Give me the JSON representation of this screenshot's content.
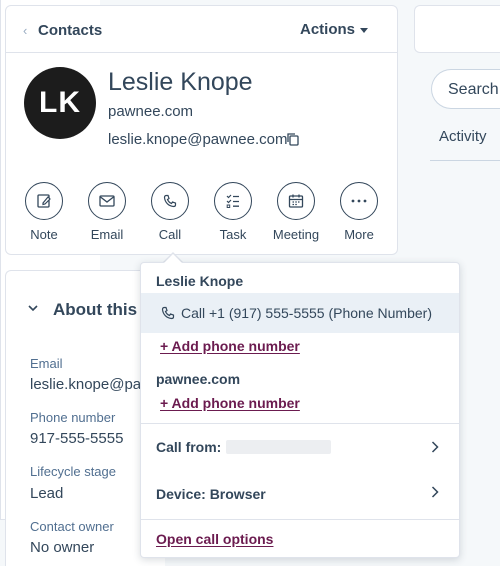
{
  "header": {
    "back_chevron": "‹",
    "title": "Contacts",
    "actions_label": "Actions"
  },
  "contact": {
    "initials": "LK",
    "name": "Leslie Knope",
    "domain": "pawnee.com",
    "email": "leslie.knope@pawnee.com"
  },
  "quick_actions": [
    {
      "label": "Note",
      "icon": "note-icon"
    },
    {
      "label": "Email",
      "icon": "email-icon"
    },
    {
      "label": "Call",
      "icon": "phone-icon"
    },
    {
      "label": "Task",
      "icon": "task-icon"
    },
    {
      "label": "Meeting",
      "icon": "meeting-icon"
    },
    {
      "label": "More",
      "icon": "more-icon"
    }
  ],
  "about": {
    "title": "About this",
    "properties": [
      {
        "label": "Email",
        "value": "leslie.knope@pav"
      },
      {
        "label": "Phone number",
        "value": "917-555-5555"
      },
      {
        "label": "Lifecycle stage",
        "value": "Lead"
      },
      {
        "label": "Contact owner",
        "value": "No owner"
      }
    ]
  },
  "right_pane": {
    "search_placeholder": "Search",
    "activity_tab": "Activity"
  },
  "call_dropdown": {
    "contact_heading": "Leslie Knope",
    "call_option": "Call +1 (917) 555-5555 (Phone Number)",
    "add_phone_1": "+ Add phone number",
    "company_heading": "pawnee.com",
    "add_phone_2": "+ Add phone number",
    "call_from_label": "Call from:",
    "device_label": "Device: Browser",
    "open_options": "Open call options"
  },
  "colors": {
    "text": "#33475b",
    "link": "#6b1b4f",
    "avatar_bg": "#1c1c1c",
    "highlight_row": "#eaf0f6"
  }
}
